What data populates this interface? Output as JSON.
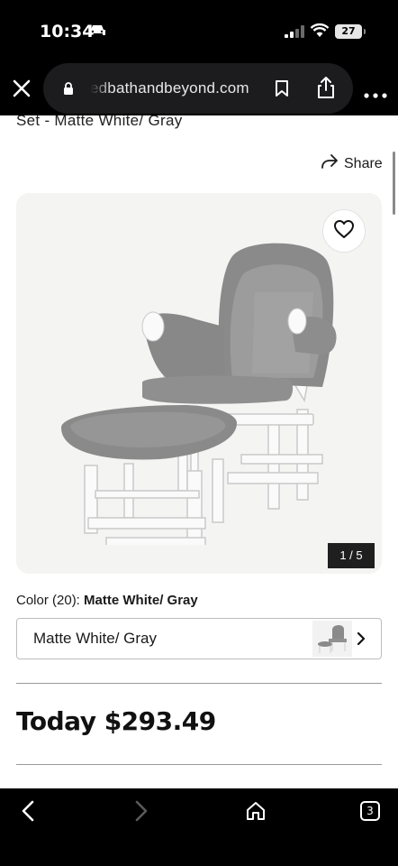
{
  "status_bar": {
    "time": "10:34",
    "battery": "27"
  },
  "browser": {
    "url": "edbathandbeyond.com",
    "tab_count": "3"
  },
  "product": {
    "title": "Set - Matte White/ Gray",
    "share_label": "Share",
    "image_counter": "1 / 5",
    "color_label": "Color (20):",
    "color_selected": "Matte White/ Gray",
    "color_dropdown_value": "Matte White/ Gray",
    "price": "Today $293.49"
  },
  "colors": {
    "page_bg": "#ffffff",
    "browser_chrome": "#000000",
    "gallery_bg": "#f4f4f3"
  },
  "icons": {
    "close": "close-icon",
    "lock": "lock-icon",
    "bookmark": "bookmark-icon",
    "share": "share-icon",
    "more": "more-icon",
    "heart": "heart-icon",
    "chevron": "chevron-right-icon",
    "back": "back-icon",
    "forward": "forward-icon",
    "home": "home-icon",
    "tabs": "tabs-icon"
  }
}
